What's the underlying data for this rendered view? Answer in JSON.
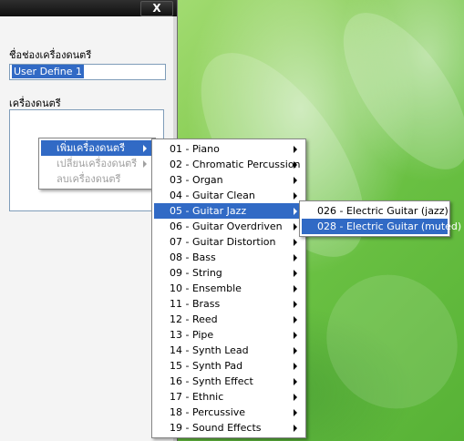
{
  "window": {
    "close_label": "X",
    "instrument_channel_label": "ชื่อช่องเครื่องดนตรี",
    "instrument_name_value": "User Define 1",
    "instruments_label": "เครื่องดนตรี"
  },
  "context_menu": {
    "items": [
      {
        "label": "เพิ่มเครื่องดนตรี",
        "state": "highlighted"
      },
      {
        "label": "เปลี่ยนเครื่องดนตรี",
        "state": "disabled"
      },
      {
        "label": "ลบเครื่องดนตรี",
        "state": "disabled"
      }
    ]
  },
  "category_menu": {
    "items": [
      "01 - Piano",
      "02 - Chromatic Percussion",
      "03 - Organ",
      "04 - Guitar Clean",
      "05 - Guitar Jazz",
      "06 - Guitar Overdriven",
      "07 - Guitar Distortion",
      "08 - Bass",
      "09 - String",
      "10 - Ensemble",
      "11 - Brass",
      "12 - Reed",
      "13 - Pipe",
      "14 - Synth Lead",
      "15 - Synth Pad",
      "16 - Synth Effect",
      "17 - Ethnic",
      "18 - Percussive",
      "19 - Sound Effects"
    ],
    "highlighted": "05 - Guitar Jazz"
  },
  "instrument_menu": {
    "items": [
      "026 - Electric Guitar (jazz)",
      "028 - Electric Guitar (muted)"
    ],
    "highlighted": "028 - Electric Guitar (muted)"
  }
}
